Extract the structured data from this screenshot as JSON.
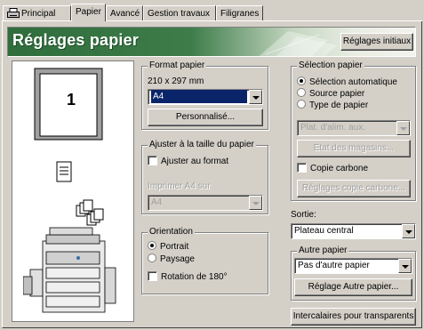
{
  "tabs": [
    {
      "label": "Principal",
      "active": false
    },
    {
      "label": "Papier",
      "active": true
    },
    {
      "label": "Avancé",
      "active": false
    },
    {
      "label": "Gestion travaux",
      "active": false
    },
    {
      "label": "Filigranes",
      "active": false
    }
  ],
  "banner": {
    "title": "Réglages papier",
    "reset_button": "Réglages initiaux"
  },
  "preview": {
    "page_number": "1"
  },
  "format": {
    "group_label": "Format papier",
    "dimensions": "210 x 297 mm",
    "selected": "A4",
    "custom_button": "Personnalisé..."
  },
  "fit": {
    "group_label": "Ajuster à la taille du papier",
    "fit_checkbox": "Ajuster au format",
    "fit_checked": false,
    "print_label": "Imprimer A4 sur",
    "print_value": "A4"
  },
  "orientation": {
    "group_label": "Orientation",
    "portrait": "Portrait",
    "landscape": "Paysage",
    "selected": "portrait",
    "rotate_checkbox": "Rotation de 180°",
    "rotate_checked": false
  },
  "source": {
    "group_label": "Sélection papier",
    "auto": "Sélection automatique",
    "paper_source": "Source papier",
    "paper_type": "Type de papier",
    "selected": "auto",
    "tray_value": "Plat. d'alim. aux.",
    "trays_status_button": "Etat des magasins...",
    "carbon_checkbox": "Copie carbone",
    "carbon_checked": false,
    "carbon_settings_button": "Réglages copie carbone..."
  },
  "output": {
    "label": "Sortie:",
    "value": "Plateau central"
  },
  "other_paper": {
    "group_label": "Autre papier",
    "value": "Pas d'autre papier",
    "settings_button": "Réglage Autre papier..."
  },
  "transparency_button": "Intercalaires pour transparents"
}
